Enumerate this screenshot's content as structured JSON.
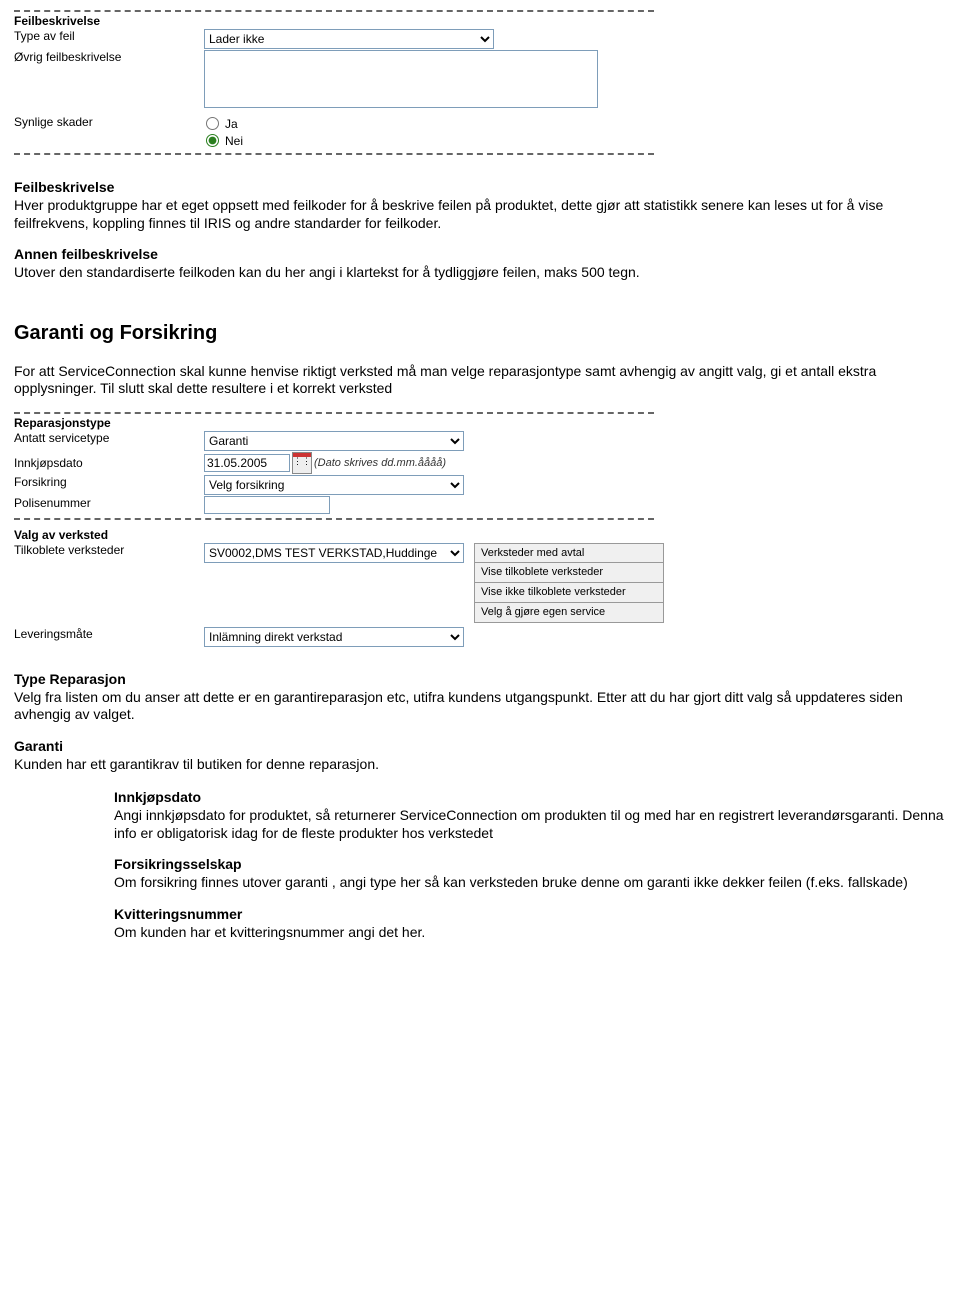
{
  "feilbeskrivelse": {
    "legend": "Feilbeskrivelse",
    "type_label": "Type av feil",
    "type_value": "Lader ikke",
    "ovrig_label": "Øvrig feilbeskrivelse",
    "ovrig_value": "",
    "synlige_label": "Synlige skader",
    "radio_ja": "Ja",
    "radio_nei": "Nei"
  },
  "doc1": {
    "h1": "Feilbeskrivelse",
    "p1": "Hver produktgruppe har et eget oppsett med feilkoder for å beskrive feilen på produktet, dette gjør att statistikk senere kan leses ut for å vise feilfrekvens, koppling finnes til IRIS og andre standarder for feilkoder.",
    "h2": "Annen feilbeskrivelse",
    "p2": "Utover den standardiserte feilkoden kan du her angi i klartekst for å tydliggjøre feilen, maks 500 tegn."
  },
  "doc2": {
    "h_big": "Garanti og Forsikring",
    "p_intro": "For att ServiceConnection skal kunne henvise riktigt verksted må man velge reparasjontype samt avhengig av angitt valg, gi et antall ekstra opplysninger. Til slutt skal dette resultere i et korrekt verksted"
  },
  "reparasjonstype": {
    "legend": "Reparasjonstype",
    "antatt_label": "Antatt servicetype",
    "antatt_value": "Garanti",
    "innkj_label": "Innkjøpsdato",
    "innkj_value": "31.05.2005",
    "innkj_hint": "(Dato skrives dd.mm.åååå)",
    "forsikring_label": "Forsikring",
    "forsikring_value": "Velg forsikring",
    "polise_label": "Polisenummer",
    "polise_value": ""
  },
  "valg_verksted": {
    "legend": "Valg av verksted",
    "tilkoblete_label": "Tilkoblete verksteder",
    "tilkoblete_value": "SV0002,DMS TEST VERKSTAD,Huddinge",
    "buttons": [
      "Verksteder med avtal",
      "Vise tilkoblete verksteder",
      "Vise ikke tilkoblete verksteder",
      "Velg å gjøre egen service"
    ],
    "lever_label": "Leveringsmåte",
    "lever_value": "Inlämning direkt verkstad"
  },
  "doc3": {
    "h_type": "Type Reparasjon",
    "p_type": "Velg fra listen om du anser att dette er en garantireparasjon etc, utifra kundens utgangspunkt. Etter att du har gjort ditt valg så uppdateres siden avhengig av valget.",
    "h_garanti": "Garanti",
    "p_garanti": "Kunden har ett garantikrav til butiken for denne reparasjon.",
    "sub_innkj_h": "Innkjøpsdato",
    "sub_innkj_p": "Angi innkjøpsdato for produktet, så returnerer ServiceConnection om produkten til og med har en registrert leverandørsgaranti. Denna info er obligatorisk idag for de fleste produkter hos verkstedet",
    "sub_fors_h": "Forsikringsselskap",
    "sub_fors_p": "Om forsikring finnes utover garanti , angi type her så kan verksteden bruke denne om garanti ikke dekker feilen (f.eks. fallskade)",
    "sub_kvitt_h": "Kvitteringsnummer",
    "sub_kvitt_p": "Om kunden har et kvitteringsnummer angi det her."
  }
}
